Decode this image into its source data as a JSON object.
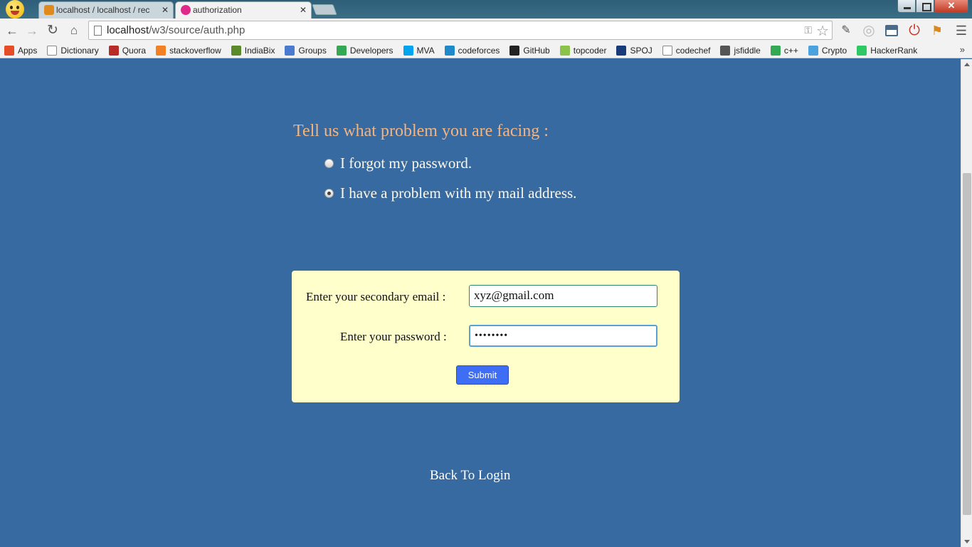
{
  "browser": {
    "tabs": [
      {
        "title": "localhost / localhost / rec",
        "active": false
      },
      {
        "title": "authorization",
        "active": true
      }
    ],
    "url": {
      "host": "localhost",
      "path": "/w3/source/auth.php"
    },
    "bookmarks": [
      {
        "label": "Apps",
        "icon": "apps-grid-icon",
        "color": "#e44d26"
      },
      {
        "label": "Dictionary",
        "icon": "page-icon",
        "color": "#ffffff"
      },
      {
        "label": "Quora",
        "icon": "quora-icon",
        "color": "#b92b27"
      },
      {
        "label": "stackoverflow",
        "icon": "stackoverflow-icon",
        "color": "#f48024"
      },
      {
        "label": "IndiaBix",
        "icon": "indiabix-icon",
        "color": "#5a8a2a"
      },
      {
        "label": "Groups",
        "icon": "groups-icon",
        "color": "#4a7bd0"
      },
      {
        "label": "Developers",
        "icon": "developers-icon",
        "color": "#34a853"
      },
      {
        "label": "MVA",
        "icon": "mva-icon",
        "color": "#00a4ef"
      },
      {
        "label": "codeforces",
        "icon": "codeforces-icon",
        "color": "#1f8acb"
      },
      {
        "label": "GitHub",
        "icon": "github-icon",
        "color": "#222222"
      },
      {
        "label": "topcoder",
        "icon": "topcoder-icon",
        "color": "#8bc34a"
      },
      {
        "label": "SPOJ",
        "icon": "spoj-icon",
        "color": "#1a3b7a"
      },
      {
        "label": "codechef",
        "icon": "page-icon",
        "color": "#ffffff"
      },
      {
        "label": "jsfiddle",
        "icon": "jsfiddle-icon",
        "color": "#555555"
      },
      {
        "label": "c++",
        "icon": "developers-icon",
        "color": "#34a853"
      },
      {
        "label": "Crypto",
        "icon": "crypto-icon",
        "color": "#4aa3df"
      },
      {
        "label": "HackerRank",
        "icon": "hackerrank-icon",
        "color": "#2ec866"
      }
    ],
    "bookmarks_more": "»"
  },
  "page": {
    "question": "Tell us what problem you are facing :",
    "options": [
      {
        "label": "I forgot my password.",
        "checked": false
      },
      {
        "label": "I have a problem with my mail address.",
        "checked": true
      }
    ],
    "form": {
      "email_label": "Enter your secondary email :",
      "email_value": "xyz@gmail.com",
      "password_label": "Enter your password :",
      "password_value": "••••••••",
      "submit_label": "Submit"
    },
    "back_link": "Back To Login"
  },
  "colors": {
    "page_bg": "#376aa1",
    "question_text": "#f0b585",
    "form_bg": "#ffffcc",
    "submit_bg": "#3d6ef5"
  }
}
